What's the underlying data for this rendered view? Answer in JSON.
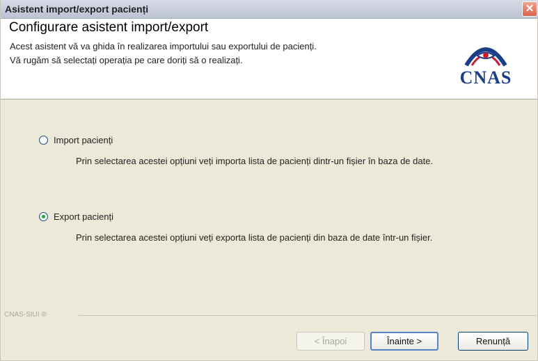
{
  "window": {
    "title": "Asistent import/export pacienți",
    "close_glyph": "✕"
  },
  "header": {
    "title": "Configurare asistent import/export",
    "description_line1": "Acest asistent vă va ghida în realizarea importului sau exportului de pacienți.",
    "description_line2": "Vă rugăm să selectați operația pe care doriți să o realizați.",
    "logo_text": "CNAS"
  },
  "options": [
    {
      "label": "Import pacienți",
      "selected": false,
      "description": "Prin selectarea acestei opțiuni veți importa lista de pacienți dintr-un fișier în baza de date."
    },
    {
      "label": "Export pacienți",
      "selected": true,
      "description": "Prin selectarea acestei opțiuni veți exporta lista de pacienți din baza de date într-un fișier."
    }
  ],
  "footer": {
    "brand": "CNAS-SIUI ®"
  },
  "buttons": {
    "back": "< Înapoi",
    "next": "Înainte >",
    "cancel": "Renunță"
  },
  "colors": {
    "title_bar": "#bcc2d4",
    "close_button": "#d6644a",
    "logo_blue": "#1b3f86",
    "logo_red": "#c8202f",
    "radio_checked": "#2ca33b"
  },
  "icons": {
    "close": "close-icon",
    "logo": "cnas-logo-icon"
  }
}
